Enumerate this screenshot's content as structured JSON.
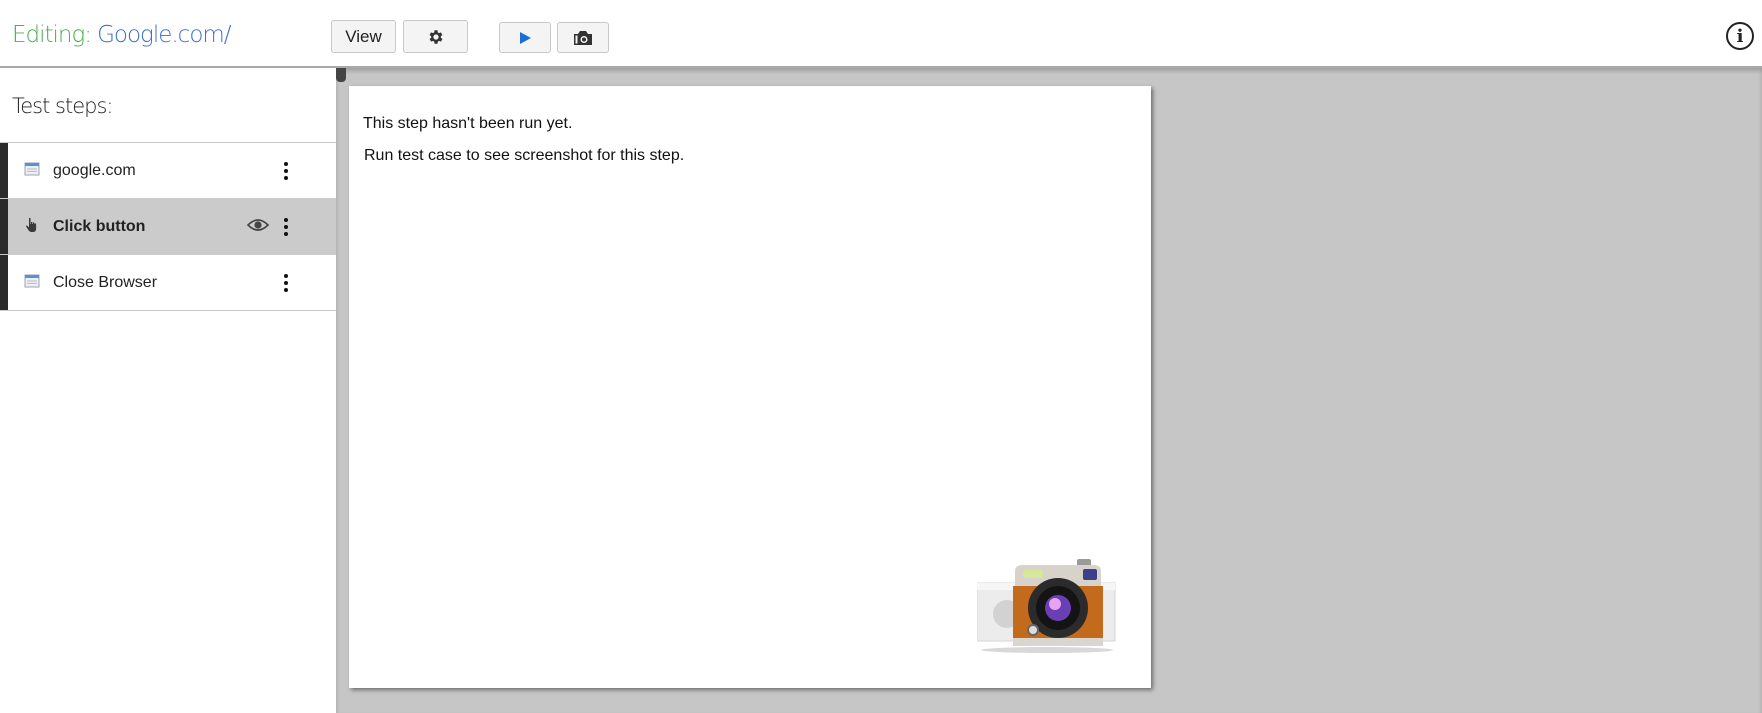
{
  "header": {
    "editing_label": "Editing:",
    "editing_value": "Google.com/",
    "buttons": {
      "view_label": "View",
      "settings_icon": "gear-icon",
      "run_icon": "play-icon",
      "screenshot_icon": "camera-icon"
    },
    "info_icon": "i"
  },
  "sidebar": {
    "title": "Test steps:",
    "steps": [
      {
        "label": "google.com",
        "icon": "browser-window-icon",
        "active": false
      },
      {
        "label": "Click button",
        "icon": "pointer-hand-icon",
        "active": true
      },
      {
        "label": "Close Browser",
        "icon": "browser-window-icon",
        "active": false
      }
    ]
  },
  "panel": {
    "message_line1": "This step hasn't been run yet.",
    "message_line2": "Run test case to see screenshot for this step.",
    "illustration": "camera-illustration"
  },
  "colors": {
    "editing_label": "#4caf50",
    "editing_value": "#3e6ed0",
    "play": "#1a6fd6",
    "active_row": "#cbcbcb",
    "stage_bg": "#c6c6c6"
  }
}
